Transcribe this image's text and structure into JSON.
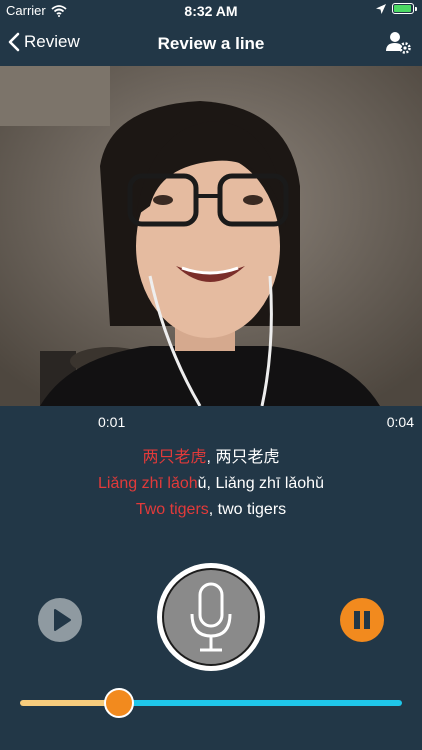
{
  "status_bar": {
    "carrier": "Carrier",
    "time": "8:32 AM",
    "battery_level": 0.95
  },
  "nav": {
    "back_label": "Review",
    "title": "Review a line"
  },
  "video": {
    "elapsed": "0:01",
    "duration": "0:04"
  },
  "lyrics": {
    "hanzi_highlight": "两只老虎",
    "hanzi_rest": ", 两只老虎",
    "pinyin_highlight": "Liǎng zhī lǎoh",
    "pinyin_rest": "ǔ, Liǎng zhī lǎohǔ",
    "english_highlight": "Two tigers",
    "english_rest": ", two tigers"
  },
  "controls": {
    "play_icon": "play-icon",
    "mic_icon": "microphone-icon",
    "pause_icon": "pause-icon"
  },
  "progress": 0.26,
  "colors": {
    "background": "#223747",
    "highlight": "#e23a3a",
    "accent": "#f28a1e",
    "track_rest": "#1fc6ea",
    "track_done": "#f7cc7d"
  }
}
